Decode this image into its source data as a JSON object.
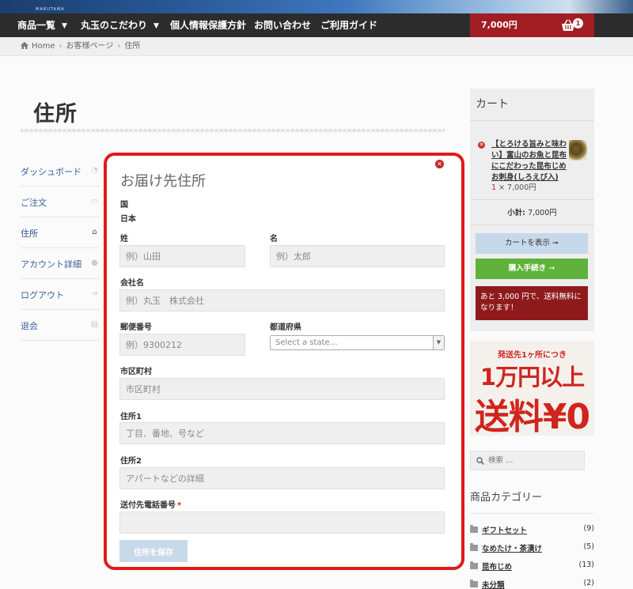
{
  "brand": {
    "tag": "MARUTAMA"
  },
  "nav": {
    "items": [
      {
        "label": "商品一覧",
        "has_dropdown": true
      },
      {
        "label": "丸玉のこだわり",
        "has_dropdown": true
      },
      {
        "label": "個人情報保護方針",
        "has_dropdown": false
      },
      {
        "label": "お問い合わせ",
        "has_dropdown": false
      },
      {
        "label": "ご利用ガイド",
        "has_dropdown": false
      }
    ],
    "cart_amount": "7,000円",
    "cart_count": "1"
  },
  "breadcrumb": [
    "Home",
    "お客様ページ",
    "住所"
  ],
  "page_title": "住所",
  "account_nav": [
    {
      "label": "ダッシュボード",
      "icon": "dashboard-icon"
    },
    {
      "label": "ご注文",
      "icon": "basket-icon"
    },
    {
      "label": "住所",
      "icon": "home-icon",
      "active": true
    },
    {
      "label": "アカウント詳細",
      "icon": "user-icon"
    },
    {
      "label": "ログアウト",
      "icon": "logout-icon"
    },
    {
      "label": "退会",
      "icon": "document-icon"
    }
  ],
  "modal": {
    "title": "お届け先住所",
    "country_label": "国",
    "country_value": "日本",
    "last_name_label": "姓",
    "last_name_placeholder": "例）山田",
    "first_name_label": "名",
    "first_name_placeholder": "例）太郎",
    "company_label": "会社名",
    "company_placeholder": "例）丸玉　株式会社",
    "postcode_label": "郵便番号",
    "postcode_placeholder": "例）9300212",
    "state_label": "都道府県",
    "state_placeholder": "Select a state…",
    "city_label": "市区町村",
    "city_placeholder": "市区町村",
    "address1_label": "住所1",
    "address1_placeholder": "丁目、番地、号など",
    "address2_label": "住所2",
    "address2_placeholder": "アパートなどの詳細",
    "phone_label": "送付先電話番号",
    "required_mark": "*",
    "save_label": "住所を保存"
  },
  "cart_widget": {
    "title": "カート",
    "item_name": "【とろける旨みと味わい】富山のお魚と昆布にこだわった昆布じめお刺身(しろえび入)",
    "item_qty": "1",
    "item_price": "× 7,000円",
    "subtotal_label": "小計:",
    "subtotal_value": "7,000円",
    "view_cart": "カートを表示 ➞",
    "checkout": "購入手続き ➞",
    "notice": "あと 3,000 円で、送料無料になります！"
  },
  "promo": {
    "line1": "発送先1ヶ所につき",
    "line2": "1万円以上",
    "line3": "送料¥0"
  },
  "search": {
    "placeholder": "検索 …"
  },
  "categories": {
    "title": "商品カテゴリー",
    "items": [
      {
        "name": "ギフトセット",
        "count": "(9)"
      },
      {
        "name": "なめたけ・茶漬け",
        "count": "(5)"
      },
      {
        "name": "昆布じめ",
        "count": "(13)"
      },
      {
        "name": "未分類",
        "count": "(2)"
      }
    ]
  },
  "colors": {
    "accent_red": "#a01e22",
    "nav_bg": "#2c2c2c",
    "link_blue": "#3a5f9e",
    "highlight_border": "#e11a1a"
  }
}
